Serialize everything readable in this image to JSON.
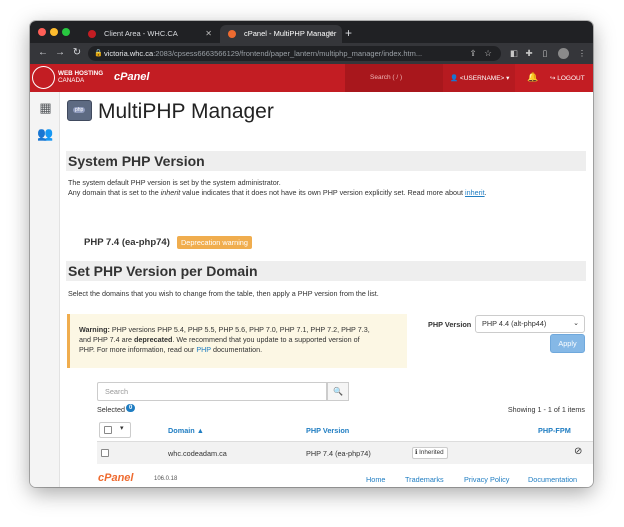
{
  "browser": {
    "tabs": [
      {
        "title": "Client Area - WHC.CA",
        "close": "✕"
      },
      {
        "title": "cPanel - MultiPHP Manager",
        "close": "✕"
      }
    ],
    "new_tab": "+",
    "url_host": "victoria.whc.ca",
    "url_rest": ":2083/cpsess6663566129/frontend/paper_lantern/multiphp_manager/index.htm..."
  },
  "header": {
    "logo_line1": "WEB HOSTING",
    "logo_line2": "CANADA",
    "brand": "cPanel",
    "search_placeholder": "Search ( / )",
    "username": "<USERNAME>",
    "logout": "LOGOUT"
  },
  "page": {
    "title": "MultiPHP Manager"
  },
  "system_section": {
    "title": "System PHP Version",
    "line1": "The system default PHP version is set by the system administrator.",
    "line2_a": "Any domain that is set to the ",
    "line2_italic": "inherit",
    "line2_b": " value indicates that it does not have its own PHP version explicitly set. Read more about ",
    "line2_link": "inherit",
    "line2_end": ".",
    "version": "PHP 7.4 (ea-php74)",
    "badge": "Deprecation warning"
  },
  "domain_section": {
    "title": "Set PHP Version per Domain",
    "description": "Select the domains that you wish to change from the table, then apply a PHP version from the list."
  },
  "warning": {
    "label": "Warning:",
    "line1": " PHP versions PHP 5.4, PHP 5.5, PHP 5.6, PHP 7.0, PHP 7.1, PHP 7.2, PHP 7.3,",
    "line2_a": "and PHP 7.4 are ",
    "line2_bold": "deprecated",
    "line2_b": ". We recommend that you update to a supported version of",
    "line3_a": "PHP. For more information, read our ",
    "line3_link": "PHP",
    "line3_b": " documentation."
  },
  "php_selector": {
    "label": "PHP Version",
    "selected": "PHP 4.4 (alt-php44)",
    "apply": "Apply"
  },
  "table": {
    "search_placeholder": "Search",
    "selected_label": "Selected",
    "selected_count": "0",
    "showing": "Showing 1 - 1 of 1 items",
    "headers": {
      "domain": "Domain ▲",
      "php_version": "PHP Version",
      "php_fpm": "PHP-FPM"
    },
    "rows": [
      {
        "domain": "whc.codeadam.ca",
        "php_version": "PHP 7.4 (ea-php74)",
        "badge": "Inherited"
      }
    ]
  },
  "footer": {
    "brand": "cPanel",
    "version": "106.0.18",
    "links": [
      "Home",
      "Trademarks",
      "Privacy Policy",
      "Documentation"
    ]
  },
  "colors": {
    "header_red": "#c31d23",
    "link_blue": "#1f7dc2",
    "warning_orange": "#f0ad4e",
    "footer_orange": "#ee6b30"
  }
}
